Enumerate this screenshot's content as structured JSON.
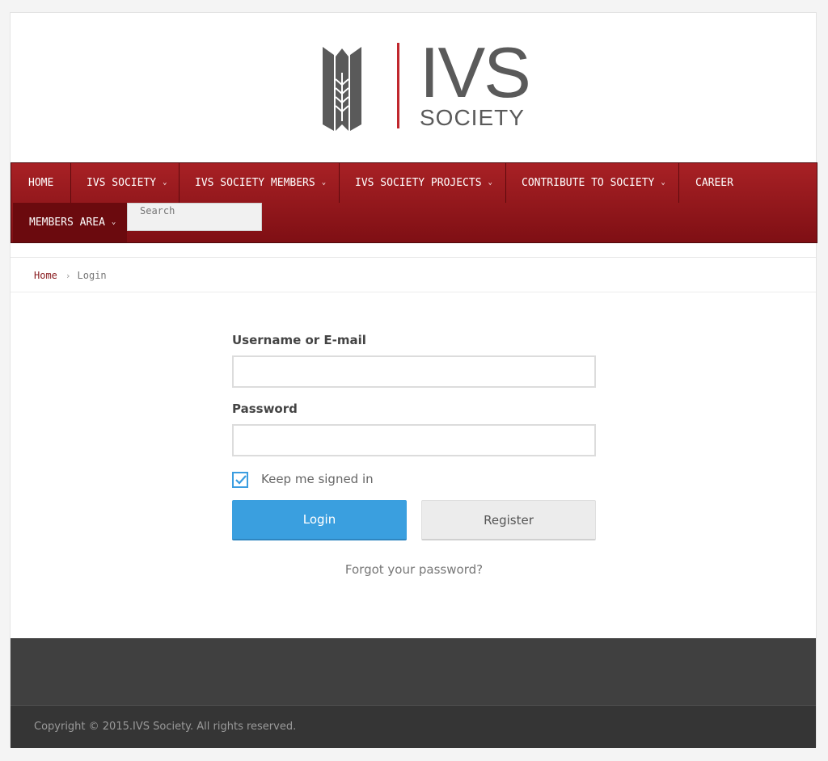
{
  "logo": {
    "text": "IVS",
    "subtext": "SOCIETY"
  },
  "nav": {
    "items": [
      {
        "label": "HOME",
        "has_dropdown": false
      },
      {
        "label": "IVS SOCIETY",
        "has_dropdown": true
      },
      {
        "label": "IVS SOCIETY MEMBERS",
        "has_dropdown": true
      },
      {
        "label": "IVS SOCIETY PROJECTS",
        "has_dropdown": true
      },
      {
        "label": "CONTRIBUTE TO SOCIETY",
        "has_dropdown": true
      },
      {
        "label": "CAREER",
        "has_dropdown": false
      },
      {
        "label": "MEMBERS AREA",
        "has_dropdown": true,
        "active": true
      }
    ],
    "search_placeholder": "Search"
  },
  "breadcrumb": {
    "home": "Home",
    "separator": "›",
    "current": "Login"
  },
  "form": {
    "username_label": "Username or E-mail",
    "username_value": "",
    "password_label": "Password",
    "password_value": "",
    "remember_label": "Keep me signed in",
    "remember_checked": true,
    "login_button": "Login",
    "register_button": "Register",
    "forgot_link": "Forgot your password?"
  },
  "footer": {
    "copyright": "Copyright © 2015.IVS Society. All rights reserved."
  },
  "colors": {
    "nav_red": "#a82125",
    "accent_blue": "#3a9fdf",
    "breadcrumb_link": "#8a1d20",
    "footer_dark": "#404040"
  },
  "icons": {
    "chevron": "chevron-down-icon",
    "check": "check-icon"
  }
}
